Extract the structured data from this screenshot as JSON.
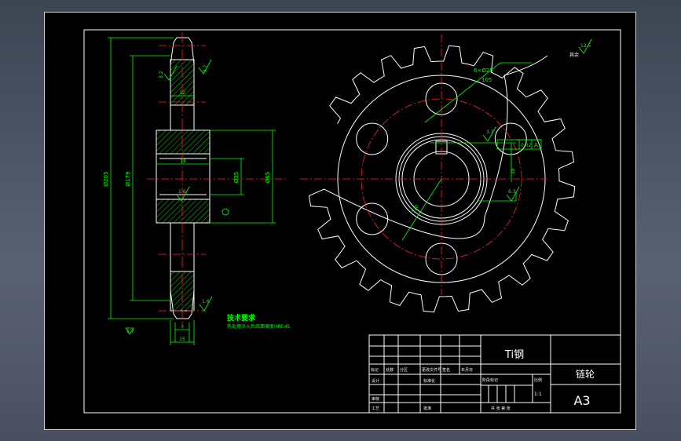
{
  "drawing": {
    "dims_front": {
      "d_205": "Ø205",
      "d_179": "Ø179",
      "d_35": "Ø35",
      "d_65": "Ø65",
      "w_12": "12",
      "w_18": "18",
      "w_3": "3",
      "w_15": "15",
      "r_3_2": "3.2",
      "r_3_7": "3.7",
      "r_1_6a": "1.6",
      "r_1_6b": "1.6",
      "r_3_7b": "3.7"
    },
    "dims_side": {
      "holes": "6×Ø25",
      "pcd": "105",
      "r_3_7": "3.7",
      "tol": "0.02",
      "datum": "A",
      "r_6_3": "6.3",
      "dim_38": "38",
      "dim_120": "120",
      "corner_label": "其余",
      "corner_value": "12.5"
    },
    "tech": {
      "heading": "技术要求",
      "line1": "热处理淬火后齿面硬度HRC45"
    }
  },
  "title_block": {
    "material": "Ti钢",
    "part_name": "链轮",
    "sheet_size": "A3",
    "row_labels": [
      "标记",
      "处数",
      "分区",
      "更改文件号",
      "签名",
      "年月日"
    ],
    "design_label": "设计",
    "std_label": "标准化",
    "check_label": "审核",
    "process_label": "工艺",
    "approve_label": "批准",
    "stage_label": "阶段标记",
    "weight_label": "重量",
    "scale_label": "比例",
    "scale_value": "1:1",
    "sheet_text": "共 张 第 张"
  }
}
